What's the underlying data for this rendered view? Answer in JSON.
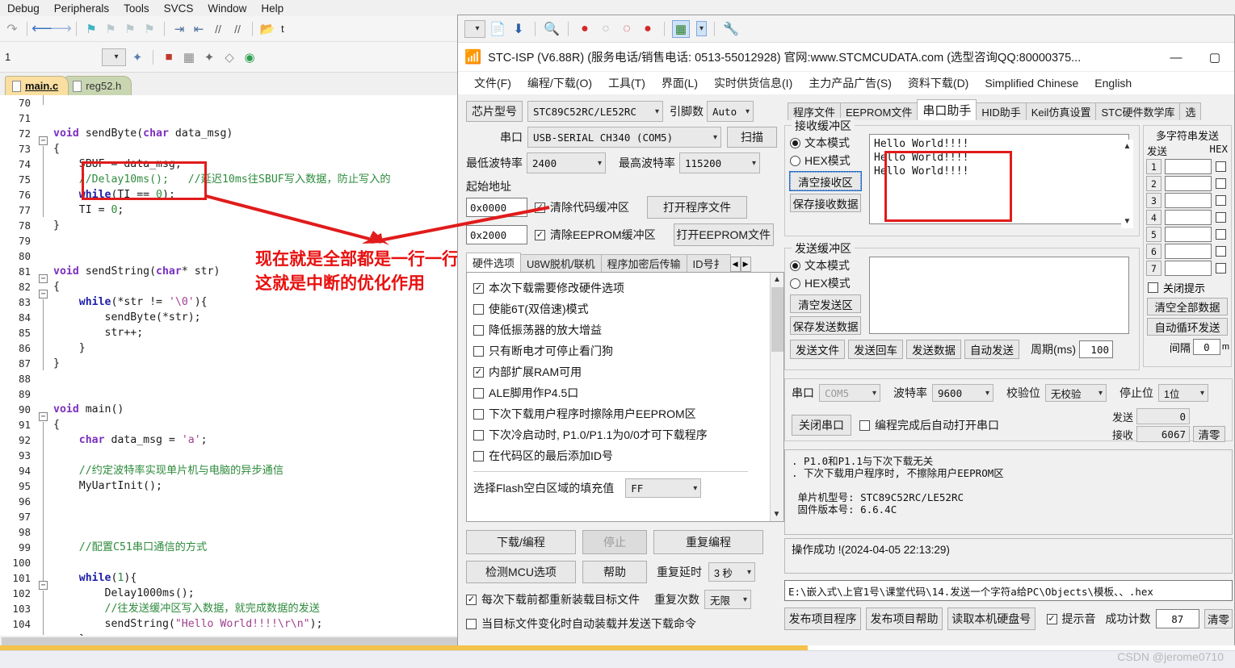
{
  "keil": {
    "menu": [
      "Debug",
      "Peripherals",
      "Tools",
      "SVCS",
      "Window",
      "Help"
    ],
    "tabs": [
      {
        "label": "main.c",
        "active": true
      },
      {
        "label": "reg52.h",
        "active": false
      }
    ],
    "toolbar2_label": "1",
    "toolbar1_trailing_label": "t",
    "code_start_line": 70,
    "code_lines": [
      {
        "n": 70,
        "html": ""
      },
      {
        "n": 71,
        "html": ""
      },
      {
        "n": 72,
        "html": "<span class='kw'>void</span> sendByte(<span class='kw'>char</span> data_msg)"
      },
      {
        "n": 73,
        "html": "{"
      },
      {
        "n": 74,
        "html": "    SBUF = data_msg;"
      },
      {
        "n": 75,
        "html": "    <span class='cm'>//Delay10ms();   //延迟10ms往SBUF写入数据，防止写入的</span>"
      },
      {
        "n": 76,
        "html": "    <span class='kwb'>while</span>(TI == <span class='num'>0</span>);"
      },
      {
        "n": 77,
        "html": "    TI = <span class='num'>0</span>;"
      },
      {
        "n": 78,
        "html": "}"
      },
      {
        "n": 79,
        "html": ""
      },
      {
        "n": 80,
        "html": ""
      },
      {
        "n": 81,
        "html": "<span class='kw'>void</span> sendString(<span class='kw'>char</span>* str)"
      },
      {
        "n": 82,
        "html": "{"
      },
      {
        "n": 83,
        "html": "    <span class='kwb'>while</span>(*str != <span class='st'>'\\0'</span>){"
      },
      {
        "n": 84,
        "html": "        sendByte(*str);"
      },
      {
        "n": 85,
        "html": "        str++;"
      },
      {
        "n": 86,
        "html": "    }"
      },
      {
        "n": 87,
        "html": "}"
      },
      {
        "n": 88,
        "html": ""
      },
      {
        "n": 89,
        "html": ""
      },
      {
        "n": 90,
        "html": "<span class='kw'>void</span> main()"
      },
      {
        "n": 91,
        "html": "{"
      },
      {
        "n": 92,
        "html": "    <span class='kw'>char</span> data_msg = <span class='st'>'a'</span>;"
      },
      {
        "n": 93,
        "html": ""
      },
      {
        "n": 94,
        "html": "    <span class='cm'>//约定波特率实现单片机与电脑的异步通信</span>"
      },
      {
        "n": 95,
        "html": "    MyUartInit();"
      },
      {
        "n": 96,
        "html": ""
      },
      {
        "n": 97,
        "html": ""
      },
      {
        "n": 98,
        "html": ""
      },
      {
        "n": 99,
        "html": "    <span class='cm'>//配置C51串口通信的方式</span>"
      },
      {
        "n": 100,
        "html": ""
      },
      {
        "n": 101,
        "html": "    <span class='kwb'>while</span>(<span class='num'>1</span>){"
      },
      {
        "n": 102,
        "html": "        Delay1000ms();"
      },
      {
        "n": 103,
        "html": "        <span class='cm'>//往发送缓冲区写入数据，就完成数据的发送</span>"
      },
      {
        "n": 104,
        "html": "        sendString(<span class='st'>\"Hello World!!!!\\r\\n\"</span>);"
      },
      {
        "n": 105,
        "html": "    }"
      }
    ],
    "annotations": {
      "line1": "现在就是全部都是一行一行的写入",
      "line2": "这就是中断的优化作用",
      "color": "#e8100f"
    }
  },
  "stc": {
    "title": "STC-ISP (V6.88R) (服务电话/销售电话: 0513-55012928) 官网:www.STCMCUDATA.com  (选型咨询QQ:80000375...",
    "window_buttons": {
      "minimize": "—",
      "maximize": "▢"
    },
    "menu": [
      "文件(F)",
      "编程/下载(O)",
      "工具(T)",
      "界面(L)",
      "实时供货信息(I)",
      "主力产品广告(S)",
      "资料下载(D)",
      "Simplified Chinese",
      "English"
    ],
    "left": {
      "chip_label": "芯片型号",
      "chip_value": "STC89C52RC/LE52RC",
      "pins_label": "引脚数",
      "pins_value": "Auto",
      "port_label": "串口",
      "port_value": "USB-SERIAL CH340 (COM5)",
      "scan_button": "扫描",
      "min_baud_label": "最低波特率",
      "min_baud_value": "2400",
      "max_baud_label": "最高波特率",
      "max_baud_value": "115200",
      "start_addr_label": "起始地址",
      "addr1": "0x0000",
      "addr2": "0x2000",
      "clear_code_buf": "清除代码缓冲区",
      "clear_eeprom_buf": "清除EEPROM缓冲区",
      "open_program_file": "打开程序文件",
      "open_eeprom_file": "打开EEPROM文件",
      "tabs": [
        {
          "label": "硬件选项",
          "active": true
        },
        {
          "label": "U8W脱机/联机",
          "active": false
        },
        {
          "label": "程序加密后传输",
          "active": false
        },
        {
          "label": "ID号扌",
          "active": false
        }
      ],
      "options": [
        {
          "label": "本次下载需要修改硬件选项",
          "checked": true
        },
        {
          "label": "使能6T(双倍速)模式",
          "checked": false
        },
        {
          "label": "降低振荡器的放大增益",
          "checked": false
        },
        {
          "label": "只有断电才可停止看门狗",
          "checked": false
        },
        {
          "label": "内部扩展RAM可用",
          "checked": true
        },
        {
          "label": "ALE脚用作P4.5口",
          "checked": false
        },
        {
          "label": "下次下载用户程序时擦除用户EEPROM区",
          "checked": false
        },
        {
          "label": "下次冷启动时, P1.0/P1.1为0/0才可下载程序",
          "checked": false
        },
        {
          "label": "在代码区的最后添加ID号",
          "checked": false
        }
      ],
      "flash_fill_label": "选择Flash空白区域的填充值",
      "flash_fill_value": "FF",
      "download_button": "下载/编程",
      "stop_button": "停止",
      "repeat_button": "重复编程",
      "detect_mcu_button": "检测MCU选项",
      "help_button": "帮助",
      "repeat_delay_label": "重复延时",
      "repeat_delay_value": "3 秒",
      "repeat_count_label": "重复次数",
      "repeat_count_value": "无限",
      "reload_checkbox": "每次下载前都重新装载目标文件",
      "reload_checked": true,
      "autoload_checkbox": "当目标文件变化时自动装载并发送下载命令",
      "autoload_checked": false
    },
    "right": {
      "tabs": [
        {
          "label": "程序文件",
          "active": false
        },
        {
          "label": "EEPROM文件",
          "active": false
        },
        {
          "label": "串口助手",
          "active": true
        },
        {
          "label": "HID助手",
          "active": false
        },
        {
          "label": "Keil仿真设置",
          "active": false
        },
        {
          "label": "STC硬件数学库",
          "active": false
        },
        {
          "label": "选",
          "active": false
        }
      ],
      "recv_group": "接收缓冲区",
      "recv_text_mode": "文本模式",
      "recv_hex_mode": "HEX模式",
      "recv_mode_selected": "text",
      "clear_recv_button": "清空接收区",
      "save_recv_button": "保存接收数据",
      "recv_content": "Hello World!!!!\nHello World!!!!\nHello World!!!!",
      "send_group": "发送缓冲区",
      "send_text_mode": "文本模式",
      "send_hex_mode": "HEX模式",
      "send_mode_selected": "text",
      "clear_send_button": "清空发送区",
      "save_send_button": "保存发送数据",
      "send_content": "",
      "send_file_button": "发送文件",
      "send_cr_button": "发送回车",
      "send_data_button": "发送数据",
      "auto_send_button": "自动发送",
      "period_label": "周期(ms)",
      "period_value": "100",
      "port_label": "串口",
      "port_value": "COM5",
      "baud_label": "波特率",
      "baud_value": "9600",
      "parity_label": "校验位",
      "parity_value": "无校验",
      "stopbit_label": "停止位",
      "stopbit_value": "1位",
      "close_port_button": "关闭串口",
      "auto_open_checkbox": "编程完成后自动打开串口",
      "auto_open_checked": false,
      "tx_label": "发送",
      "tx_value": "0",
      "rx_label": "接收",
      "rx_value": "6067",
      "clear_counter_button": "清零",
      "multi_group": "多字符串发送",
      "multi_send_label": "发送",
      "multi_hex_label": "HEX",
      "multi_rows": [
        "1",
        "2",
        "3",
        "4",
        "5",
        "6",
        "7"
      ],
      "close_tip_checkbox": "关闭提示",
      "close_tip_checked": false,
      "clear_all_button": "清空全部数据",
      "auto_loop_button": "自动循环发送",
      "interval_label": "间隔",
      "interval_value": "0",
      "interval_unit": "m",
      "info_lines": [
        ". P1.0和P1.1与下次下载无关",
        ". 下次下载用户程序时, 不擦除用户EEPROM区",
        "",
        " 单片机型号: STC89C52RC/LE52RC",
        " 固件版本号: 6.6.4C"
      ],
      "status_line": "操作成功 !(2024-04-05 22:13:29)",
      "file_path": "E:\\嵌入式\\上官1号\\课堂代码\\14.发送一个字符a给PC\\Objects\\模板、、.hex",
      "publish_program_button": "发布项目程序",
      "publish_help_button": "发布项目帮助",
      "read_disk_button": "读取本机硬盘号",
      "beep_checkbox": "提示音",
      "beep_checked": true,
      "success_count_label": "成功计数",
      "success_count_value": "87",
      "clear_button": "清零"
    }
  },
  "watermark": "CSDN @jerome0710"
}
